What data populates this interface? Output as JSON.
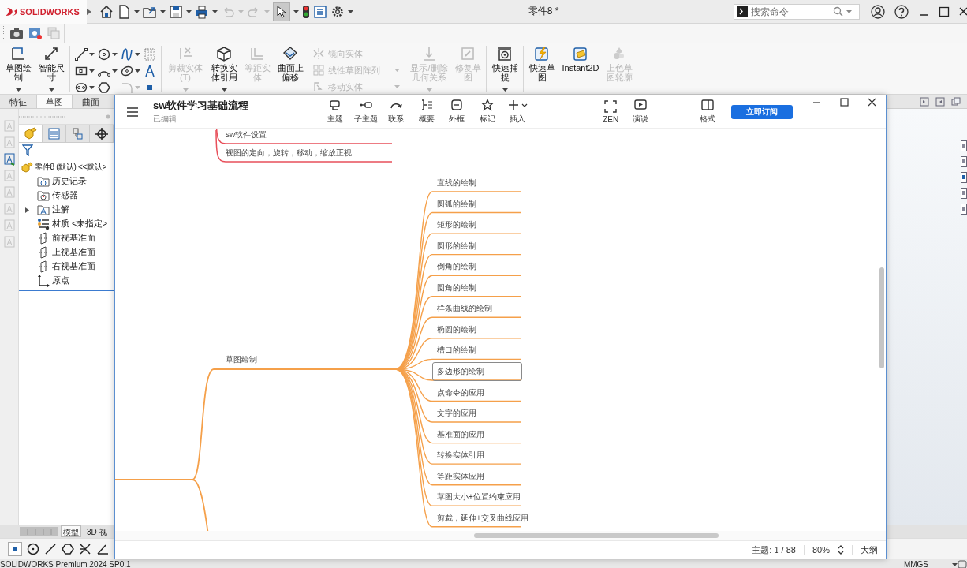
{
  "solidworks": {
    "logo": "SOLIDWORKS",
    "document_title": "零件8 *",
    "search": {
      "placeholder": "搜索命令"
    },
    "ribbon": [
      {
        "kind": "buttons",
        "separator": false,
        "items": [
          {
            "label": "草图绘制",
            "disabled": false,
            "dropdown": true
          },
          {
            "label": "智能尺寸",
            "disabled": false,
            "dropdown": true
          }
        ]
      },
      {
        "kind": "tool_grid",
        "separator": true
      },
      {
        "kind": "buttons",
        "separator": true,
        "items": [
          {
            "label": "剪裁实体(T)",
            "disabled": true,
            "dropdown": true
          },
          {
            "label": "转换实体引用",
            "disabled": false,
            "dropdown": true
          },
          {
            "label": "等距实体",
            "disabled": true,
            "dropdown": false
          },
          {
            "label": "曲面上偏移",
            "disabled": false,
            "dropdown": false
          }
        ]
      },
      {
        "kind": "stack",
        "separator": false,
        "items": [
          {
            "label": "镜向实体",
            "disabled": true,
            "dropdown": false
          },
          {
            "label": "线性草图阵列",
            "disabled": true,
            "dropdown": true
          },
          {
            "label": "移动实体",
            "disabled": true,
            "dropdown": true
          }
        ]
      },
      {
        "kind": "buttons",
        "separator": true,
        "items": [
          {
            "label": "显示/删除几何关系",
            "disabled": true,
            "dropdown": true
          },
          {
            "label": "修复草图",
            "disabled": true,
            "dropdown": false
          }
        ]
      },
      {
        "kind": "buttons",
        "separator": true,
        "items": [
          {
            "label": "快速捕捉",
            "disabled": false,
            "dropdown": true
          }
        ]
      },
      {
        "kind": "buttons",
        "separator": true,
        "items": [
          {
            "label": "快速草图",
            "disabled": false,
            "dropdown": false
          },
          {
            "label": "Instant2D",
            "disabled": false,
            "dropdown": false
          },
          {
            "label": "上色草图轮廓",
            "disabled": true,
            "dropdown": false
          }
        ]
      }
    ],
    "command_tabs": [
      {
        "label": "特征",
        "selected": false
      },
      {
        "label": "草图",
        "selected": true
      },
      {
        "label": "曲面",
        "selected": false
      }
    ],
    "panel_tabs": [
      {
        "selected": true
      },
      {
        "selected": false
      },
      {
        "selected": false
      },
      {
        "selected": false
      }
    ],
    "feature_tree": {
      "root": "零件8 (默认) <<默认>",
      "items": [
        {
          "label": "历史记录",
          "expandable": false
        },
        {
          "label": "传感器",
          "expandable": false
        },
        {
          "label": "注解",
          "expandable": true
        },
        {
          "label": "材质 <未指定>",
          "expandable": false
        },
        {
          "label": "前视基准面",
          "expandable": false
        },
        {
          "label": "上视基准面",
          "expandable": false
        },
        {
          "label": "右视基准面",
          "expandable": false
        },
        {
          "label": "原点",
          "expandable": false
        }
      ]
    },
    "model_tabs": [
      {
        "label": "模型",
        "selected": true
      },
      {
        "label": "3D 视",
        "selected": false
      }
    ],
    "status_bar": {
      "product": "SOLIDWORKS Premium 2024 SP0.1",
      "units": "MMGS"
    }
  },
  "mindmap": {
    "title": "sw软件学习基础流程",
    "subtitle": "已编辑",
    "tools": [
      {
        "label": "主题",
        "dropdown": false
      },
      {
        "label": "子主题",
        "dropdown": false
      },
      {
        "label": "联系",
        "dropdown": false
      },
      {
        "label": "概要",
        "dropdown": false
      },
      {
        "label": "外框",
        "dropdown": false
      },
      {
        "label": "标记",
        "dropdown": false
      },
      {
        "label": "插入",
        "dropdown": true
      }
    ],
    "view_tools": [
      {
        "label": "ZEN"
      },
      {
        "label": "演说"
      }
    ],
    "format": "格式",
    "subscribe": "立即订阅",
    "upper_branch": {
      "color": "#e8505b",
      "nodes": [
        {
          "text": "sw软件设置",
          "selected": false
        },
        {
          "text": "视图的定向，旋转，移动，缩放正视",
          "selected": false
        }
      ]
    },
    "sketch_branch": {
      "color": "#f5a04a",
      "topic": {
        "text": "草图绘制",
        "selected": false
      },
      "children": [
        {
          "text": "直线的绘制",
          "selected": false
        },
        {
          "text": "圆弧的绘制",
          "selected": false
        },
        {
          "text": "矩形的绘制",
          "selected": false
        },
        {
          "text": "圆形的绘制",
          "selected": false
        },
        {
          "text": "倒角的绘制",
          "selected": false
        },
        {
          "text": "圆角的绘制",
          "selected": false
        },
        {
          "text": "样条曲线的绘制",
          "selected": false
        },
        {
          "text": "椭圆的绘制",
          "selected": false
        },
        {
          "text": "槽口的绘制",
          "selected": false
        },
        {
          "text": "多边形的绘制",
          "selected": true
        },
        {
          "text": "点命令的应用",
          "selected": false
        },
        {
          "text": "文字的应用",
          "selected": false
        },
        {
          "text": "基准面的应用",
          "selected": false
        },
        {
          "text": "转换实体引用",
          "selected": false
        },
        {
          "text": "等距实体应用",
          "selected": false
        },
        {
          "text": "草图大小+位置约束应用",
          "selected": false
        },
        {
          "text": "剪裁，延伸+交叉曲线应用",
          "selected": false
        }
      ]
    },
    "footer": {
      "topic_count": "主题: 1 / 88",
      "zoom": "80%",
      "outline": "大纲"
    }
  }
}
